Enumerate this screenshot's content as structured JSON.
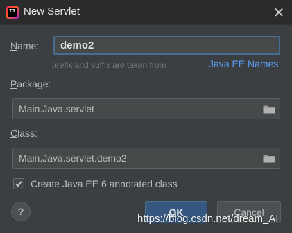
{
  "window": {
    "title": "New Servlet",
    "app_icon": "intellij-idea-icon",
    "app_icon_text": "IJ",
    "close_glyph": "✕"
  },
  "form": {
    "name": {
      "label_mnemonic": "N",
      "label_rest": "ame:",
      "value": "demo2",
      "hint": "prefix and suffix are taken from",
      "link": "Java EE Names"
    },
    "package": {
      "label_mnemonic": "P",
      "label_rest": "ackage:",
      "value": "Main.Java.servlet"
    },
    "class": {
      "label_mnemonic": "C",
      "label_rest": "lass:",
      "value": "Main.Java.servlet.demo2"
    },
    "annotated": {
      "label": "Create Java EE 6 annotated class",
      "checked": true
    }
  },
  "buttons": {
    "help": "?",
    "ok_mnemonic": "O",
    "ok_rest": "K",
    "cancel": "Cancel"
  },
  "watermark": "https://blog.csdn.net/dream_AI",
  "colors": {
    "background": "#3c3f41",
    "titlebar": "#2b2b2b",
    "focus_border": "#466d94",
    "link": "#589df6",
    "ok_button": "#365880"
  }
}
